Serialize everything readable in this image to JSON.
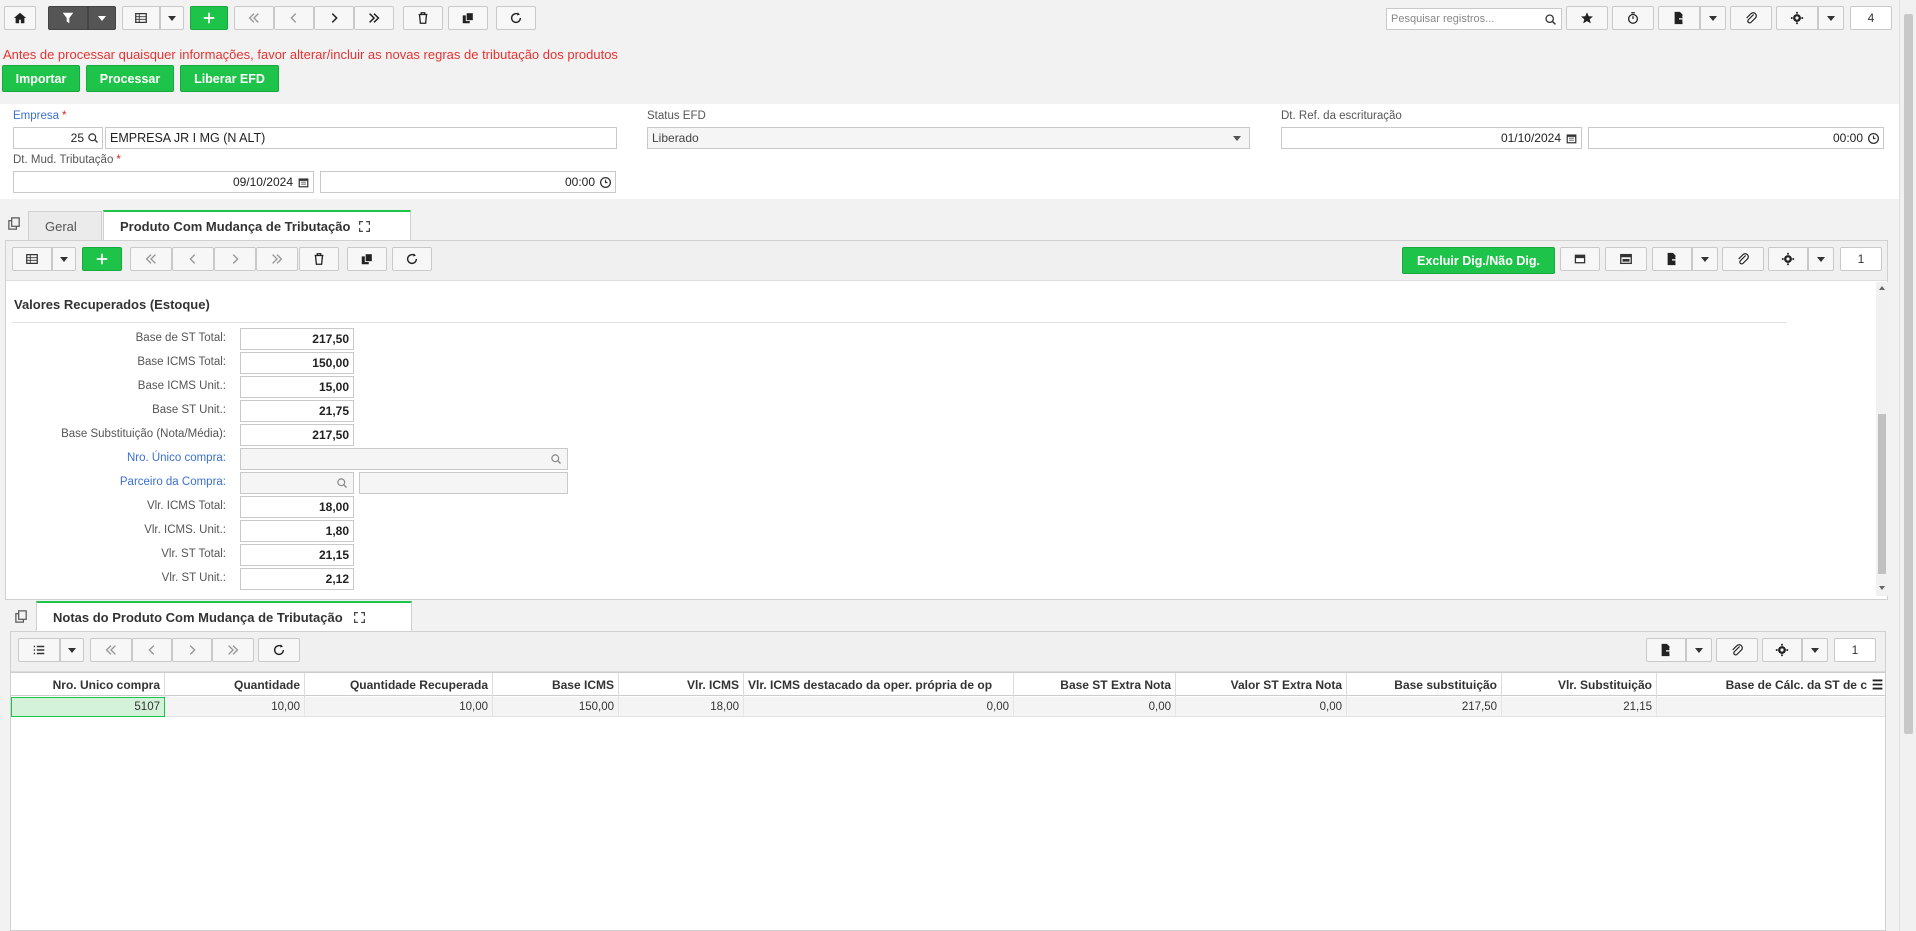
{
  "toolbar": {
    "search_placeholder": "Pesquisar registros...",
    "record_count": "4"
  },
  "warning": "Antes de processar quaisquer informações, favor alterar/incluir as novas regras de tributação dos produtos",
  "actions": {
    "import": "Importar",
    "process": "Processar",
    "release": "Liberar EFD"
  },
  "form": {
    "empresa_label": "Empresa",
    "empresa_code": "25",
    "empresa_name": "EMPRESA JR I MG (N ALT)",
    "status_label": "Status EFD",
    "status_value": "Liberado",
    "dt_ref_label": "Dt. Ref. da escrituração",
    "dt_ref_date": "01/10/2024",
    "dt_ref_time": "00:00",
    "dt_mud_label": "Dt. Mud. Tributação",
    "dt_mud_date": "09/10/2024",
    "dt_mud_time": "00:00",
    "required_mark": "*"
  },
  "tabs": {
    "general": "Geral",
    "product": "Produto Com Mudança de Tributação"
  },
  "detail_toolbar": {
    "exclude_label": "Excluir Dig./Não Dig.",
    "record_count": "1"
  },
  "section": {
    "title": "Valores Recuperados (Estoque)",
    "fields": [
      {
        "label": "Base de ST Total:",
        "value": "217,50"
      },
      {
        "label": "Base ICMS Total:",
        "value": "150,00"
      },
      {
        "label": "Base ICMS Unit.:",
        "value": "15,00"
      },
      {
        "label": "Base ST Unit.:",
        "value": "21,75"
      },
      {
        "label": "Base Substituição (Nota/Média):",
        "value": "217,50"
      }
    ],
    "nro_unico_label": "Nro. Único compra:",
    "parceiro_label": "Parceiro da Compra:",
    "fields2": [
      {
        "label": "Vlr. ICMS Total:",
        "value": "18,00"
      },
      {
        "label": "Vlr. ICMS. Unit.:",
        "value": "1,80"
      },
      {
        "label": "Vlr. ST Total:",
        "value": "21,15"
      },
      {
        "label": "Vlr. ST Unit.:",
        "value": "2,12"
      }
    ]
  },
  "notes_tab": "Notas do Produto Com Mudança de Tributação",
  "notes_toolbar": {
    "record_count": "1"
  },
  "grid": {
    "columns": [
      "Nro. Unico compra",
      "Quantidade",
      "Quantidade Recuperada",
      "Base ICMS",
      "Vlr. ICMS",
      "Vlr. ICMS destacado da oper. própria de op",
      "Base ST Extra Nota",
      "Valor ST Extra Nota",
      "Base substituição",
      "Vlr. Substituição",
      "Base de Cálc. da ST de c"
    ],
    "rows": [
      [
        "5107",
        "10,00",
        "10,00",
        "150,00",
        "18,00",
        "0,00",
        "0,00",
        "0,00",
        "217,50",
        "21,15",
        ""
      ]
    ]
  }
}
